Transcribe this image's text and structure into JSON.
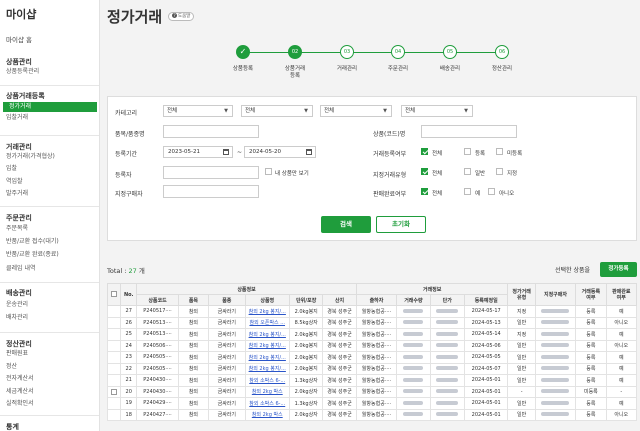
{
  "sidebar": {
    "brand": "마이샵",
    "home": "마이샵 홈",
    "groups": [
      {
        "title": "상품관리",
        "items": [
          "상품등록관리"
        ]
      },
      {
        "title": "상품거래등록",
        "items": [
          "정가거래",
          "입찰거래"
        ]
      },
      {
        "title": "거래관리",
        "items": [
          "정가거래(가격협상)",
          "입찰",
          "역입찰",
          "발주거래"
        ]
      },
      {
        "title": "주문관리",
        "items": [
          "주문목록",
          "반품/교환 접수(대기)",
          "반품/교환 완료(종료)",
          "클레임 내역"
        ]
      },
      {
        "title": "배송관리",
        "items": [
          "운송관리",
          "배차관리"
        ]
      },
      {
        "title": "정산관리",
        "items": [
          "판매원표",
          "정산",
          "전자계산서",
          "세금계산서",
          "실적확인서"
        ]
      },
      {
        "title": "통계",
        "items": []
      }
    ]
  },
  "page": {
    "title": "정가거래",
    "help": "도움말"
  },
  "steps": [
    {
      "num": "",
      "label": "상품등록"
    },
    {
      "num": "02",
      "label": "상품거래\n등록"
    },
    {
      "num": "03",
      "label": "거래관리"
    },
    {
      "num": "04",
      "label": "주문관리"
    },
    {
      "num": "05",
      "label": "배송관리"
    },
    {
      "num": "06",
      "label": "정산관리"
    }
  ],
  "search": {
    "category_label": "카테고리",
    "category_values": [
      "전체",
      "전체",
      "전체",
      "전체"
    ],
    "item_label": "품목/품종명",
    "code_label": "상품(코드)명",
    "period_label": "등록기간",
    "date_from": "2023-05-21",
    "date_sep": "~",
    "date_to": "2024-05-20",
    "trade_reg_label": "거래등록여부",
    "trade_reg_opts": [
      "전체",
      "등록",
      "미등록"
    ],
    "registrant_label": "등록자",
    "my_products": "내 상품만 보기",
    "designated_type_label": "지정거래유형",
    "designated_type_opts": [
      "전체",
      "일반",
      "지정"
    ],
    "designated_buyer_label": "지정구매자",
    "sold_label": "판매완료여부",
    "sold_opts": [
      "전체",
      "예",
      "아니오"
    ],
    "search_btn": "검색",
    "reset_btn": "초기화"
  },
  "results": {
    "total_label": "Total : ",
    "total": "27",
    "unit": " 개",
    "selected_label": "선택한 상품을",
    "register_btn": "정가등록"
  },
  "table": {
    "group_headers": {
      "no": "No.",
      "product": "상품정보",
      "trade": "거래정보",
      "type": "정가거래\n유형",
      "buyer": "지정구매자",
      "reg": "거래등록\n여부",
      "sold": "판매완료\n여부"
    },
    "columns": [
      "상품코드",
      "품목",
      "품종",
      "상품명",
      "단위/포장",
      "산지",
      "출하자",
      "거래수량",
      "단가",
      "등록예정일"
    ],
    "rows": [
      {
        "no": "27",
        "code": "P240517····",
        "item": "참외",
        "variety": "금싸라기",
        "name": "참외 2kg 봉지/...",
        "unit": "2.0kg봉지",
        "origin": "경북 성주군",
        "shipper": "월항농협공····",
        "date": "2024-05-17",
        "type": "지정",
        "reg": "등록",
        "sold": "예",
        "cb": false
      },
      {
        "no": "26",
        "code": "P240513····",
        "item": "참외",
        "variety": "금싸라기",
        "name": "참외 오픈박스 ...",
        "unit": "8.5kg상자",
        "origin": "경북 성주군",
        "shipper": "월항농협공····",
        "date": "2024-05-13",
        "type": "일반",
        "reg": "등록",
        "sold": "아니오",
        "cb": false
      },
      {
        "no": "25",
        "code": "P240513····",
        "item": "참외",
        "variety": "금싸라기",
        "name": "참외 2kg 봉지/...",
        "unit": "2.0kg봉지",
        "origin": "경북 성주군",
        "shipper": "월항농협공····",
        "date": "2024-05-14",
        "type": "지정",
        "reg": "등록",
        "sold": "예",
        "cb": false
      },
      {
        "no": "24",
        "code": "P240506····",
        "item": "참외",
        "variety": "금싸라기",
        "name": "참외 2kg 봉지/...",
        "unit": "2.0kg봉지",
        "origin": "경북 성주군",
        "shipper": "월항농협공····",
        "date": "2024-05-06",
        "type": "일반",
        "reg": "등록",
        "sold": "아니오",
        "cb": false
      },
      {
        "no": "23",
        "code": "P240505····",
        "item": "참외",
        "variety": "금싸라기",
        "name": "참외 2kg 봉지/...",
        "unit": "2.0kg봉지",
        "origin": "경북 성주군",
        "shipper": "월항농협공····",
        "date": "2024-05-05",
        "type": "일반",
        "reg": "등록",
        "sold": "예",
        "cb": false
      },
      {
        "no": "22",
        "code": "P240505····",
        "item": "참외",
        "variety": "금싸라기",
        "name": "참외 2kg 봉지/...",
        "unit": "2.0kg봉지",
        "origin": "경북 성주군",
        "shipper": "월항농협공····",
        "date": "2024-05-07",
        "type": "일반",
        "reg": "등록",
        "sold": "예",
        "cb": false
      },
      {
        "no": "21",
        "code": "P240430····",
        "item": "참외",
        "variety": "금싸라기",
        "name": "참외 소박스 6-...",
        "unit": "1.3kg상자",
        "origin": "경북 성주군",
        "shipper": "월항농협공····",
        "date": "2024-05-01",
        "type": "일반",
        "reg": "등록",
        "sold": "예",
        "cb": false
      },
      {
        "no": "20",
        "code": "P240430····",
        "item": "참외",
        "variety": "금싸라기",
        "name": "참외 2kg 박스",
        "unit": "2.0kg상자",
        "origin": "경북 성주군",
        "shipper": "월항농협공····",
        "date": "2024-05-01",
        "type": "-",
        "reg": "미등록",
        "sold": "-",
        "cb": true
      },
      {
        "no": "19",
        "code": "P240429····",
        "item": "참외",
        "variety": "금싸라기",
        "name": "참외 소박스 6-...",
        "unit": "1.3kg상자",
        "origin": "경북 성주군",
        "shipper": "월항농협공····",
        "date": "2024-05-01",
        "type": "일반",
        "reg": "등록",
        "sold": "예",
        "cb": false
      },
      {
        "no": "18",
        "code": "P240427····",
        "item": "참외",
        "variety": "금싸라기",
        "name": "참외 2kg 박스",
        "unit": "2.0kg상자",
        "origin": "경북 성주군",
        "shipper": "월항농협공····",
        "date": "2024-05-01",
        "type": "일반",
        "reg": "등록",
        "sold": "아니오",
        "cb": false
      }
    ]
  },
  "colors": {
    "accent": "#1f9d3c",
    "link": "#2a55c9"
  }
}
